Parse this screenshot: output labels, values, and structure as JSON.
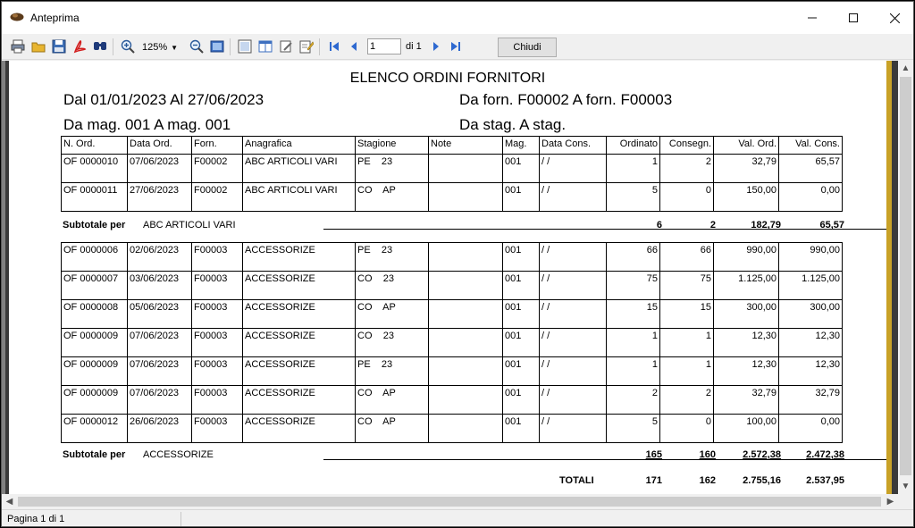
{
  "window": {
    "title": "Anteprima",
    "minimize": "—",
    "maximize": "☐",
    "close": "✕"
  },
  "toolbar": {
    "zoom": "125%",
    "page_input": "1",
    "page_of": "di 1",
    "close_label": "Chiudi",
    "icons": [
      "print-icon",
      "open-icon",
      "save-icon",
      "pdf-icon",
      "find-icon",
      "zoom-in-icon",
      "zoom-out-icon",
      "fit-page-icon",
      "page-setup-icon",
      "two-pages-icon",
      "edit-icon",
      "edit-page-icon",
      "first-page-icon",
      "prev-page-icon",
      "next-page-icon",
      "last-page-icon"
    ]
  },
  "report": {
    "title": "ELENCO ORDINI FORNITORI",
    "date_range": "Dal 01/01/2023 Al 27/06/2023",
    "supplier_range": "Da forn. F00002 A forn. F00003",
    "warehouse_range": "Da mag. 001 A mag. 001",
    "season_range": "Da stag.  A stag.",
    "columns": [
      "N. Ord.",
      "Data Ord.",
      "Forn.",
      "Anagrafica",
      "Stagione",
      "Note",
      "Mag.",
      "Data Cons.",
      "Ordinato",
      "Consegn.",
      "Val. Ord.",
      "Val. Cons."
    ],
    "group1": {
      "rows": [
        [
          "OF 0000010",
          "07/06/2023",
          "F00002",
          "ABC ARTICOLI VARI",
          "PE    23",
          "",
          "001",
          "/ /",
          "1",
          "2",
          "32,79",
          "65,57"
        ],
        [
          "OF 0000011",
          "27/06/2023",
          "F00002",
          "ABC ARTICOLI VARI",
          "CO    AP",
          "",
          "001",
          "/ /",
          "5",
          "0",
          "150,00",
          "0,00"
        ]
      ],
      "subtotal_label": "Subtotale per",
      "subtotal_name": "ABC ARTICOLI VARI",
      "subtotals": [
        "6",
        "2",
        "182,79",
        "65,57"
      ]
    },
    "group2": {
      "rows": [
        [
          "OF 0000006",
          "02/06/2023",
          "F00003",
          "ACCESSORIZE",
          "PE    23",
          "",
          "001",
          "/ /",
          "66",
          "66",
          "990,00",
          "990,00"
        ],
        [
          "OF 0000007",
          "03/06/2023",
          "F00003",
          "ACCESSORIZE",
          "CO    23",
          "",
          "001",
          "/ /",
          "75",
          "75",
          "1.125,00",
          "1.125,00"
        ],
        [
          "OF 0000008",
          "05/06/2023",
          "F00003",
          "ACCESSORIZE",
          "CO    AP",
          "",
          "001",
          "/ /",
          "15",
          "15",
          "300,00",
          "300,00"
        ],
        [
          "OF 0000009",
          "07/06/2023",
          "F00003",
          "ACCESSORIZE",
          "CO    23",
          "",
          "001",
          "/ /",
          "1",
          "1",
          "12,30",
          "12,30"
        ],
        [
          "OF 0000009",
          "07/06/2023",
          "F00003",
          "ACCESSORIZE",
          "PE    23",
          "",
          "001",
          "/ /",
          "1",
          "1",
          "12,30",
          "12,30"
        ],
        [
          "OF 0000009",
          "07/06/2023",
          "F00003",
          "ACCESSORIZE",
          "CO    AP",
          "",
          "001",
          "/ /",
          "2",
          "2",
          "32,79",
          "32,79"
        ],
        [
          "OF 0000012",
          "26/06/2023",
          "F00003",
          "ACCESSORIZE",
          "CO    AP",
          "",
          "001",
          "/ /",
          "5",
          "0",
          "100,00",
          "0,00"
        ]
      ],
      "subtotal_label": "Subtotale per",
      "subtotal_name": "ACCESSORIZE",
      "subtotals": [
        "165",
        "160",
        "2.572,38",
        "2.472,38"
      ]
    },
    "totals_label": "TOTALI",
    "totals": [
      "171",
      "162",
      "2.755,16",
      "2.537,95"
    ]
  },
  "status": {
    "page": "Pagina 1 di 1"
  },
  "colors": {
    "accent_gold": "#c9a227",
    "page_bg": "#ffffff",
    "chrome_bg": "#f0f0f0"
  }
}
